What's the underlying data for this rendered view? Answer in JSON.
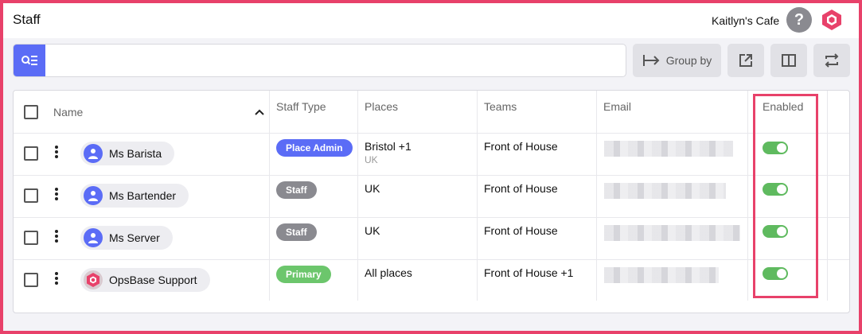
{
  "header": {
    "title": "Staff",
    "venue": "Kaitlyn's Cafe",
    "help_label": "?"
  },
  "toolbar": {
    "search_placeholder": "",
    "group_by_label": "Group by"
  },
  "table": {
    "columns": {
      "name": "Name",
      "staff_type": "Staff Type",
      "places": "Places",
      "teams": "Teams",
      "email": "Email",
      "enabled": "Enabled"
    },
    "rows": [
      {
        "name": "Ms Barista",
        "staff_type": "Place Admin",
        "places": "Bristol +1",
        "places_sub": "UK",
        "teams": "Front of House",
        "enabled": true
      },
      {
        "name": "Ms Bartender",
        "staff_type": "Staff",
        "places": "UK",
        "places_sub": "",
        "teams": "Front of House",
        "enabled": true
      },
      {
        "name": "Ms Server",
        "staff_type": "Staff",
        "places": "UK",
        "places_sub": "",
        "teams": "Front of House",
        "enabled": true
      },
      {
        "name": "OpsBase Support",
        "staff_type": "Primary",
        "places": "All places",
        "places_sub": "",
        "teams": "Front of House +1",
        "enabled": true
      }
    ]
  },
  "colors": {
    "accent": "#5b6cf6",
    "brand": "#e8416a",
    "badge_admin": "#5b6cf6",
    "badge_staff": "#8a8a90",
    "badge_primary": "#6cc66c",
    "toggle_on": "#5fba5f"
  },
  "icons": {
    "search": "search-filter-icon",
    "help": "help-icon",
    "logo": "opsbase-logo-icon",
    "group": "group-by-icon",
    "export": "export-icon",
    "columns": "columns-icon",
    "swap": "swap-icon",
    "sort": "chevron-up-icon",
    "user": "user-icon"
  }
}
